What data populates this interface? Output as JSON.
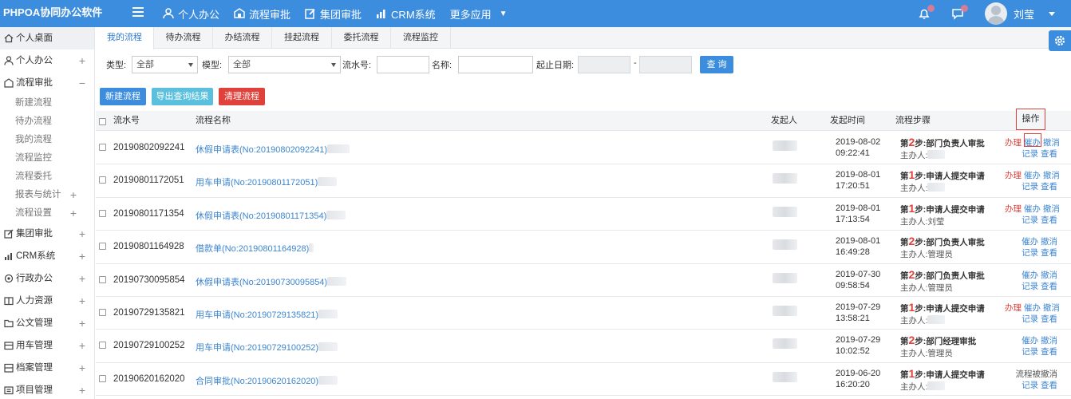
{
  "app": {
    "brand": "PHPOA协同办公软件",
    "user_name": "刘莹",
    "colors": {
      "primary": "#3c8dde",
      "danger": "#e0413a",
      "info": "#5bc0de",
      "link": "#3d86cf"
    }
  },
  "topnav": {
    "items": [
      {
        "label": "个人办公",
        "icon": "user-icon"
      },
      {
        "label": "流程审批",
        "icon": "workflow-icon"
      },
      {
        "label": "集团审批",
        "icon": "edit-icon"
      },
      {
        "label": "CRM系统",
        "icon": "bar-chart-icon"
      }
    ],
    "more_label": "更多应用"
  },
  "sidebar": {
    "items": [
      {
        "label": "个人桌面",
        "icon": "home-icon",
        "toggle": ""
      },
      {
        "label": "个人办公",
        "icon": "user-icon",
        "toggle": "+"
      },
      {
        "label": "流程审批",
        "icon": "workflow-icon",
        "toggle": "−"
      },
      {
        "label": "集团审批",
        "icon": "edit-icon",
        "toggle": "+"
      },
      {
        "label": "CRM系统",
        "icon": "bar-chart-icon",
        "toggle": "+"
      },
      {
        "label": "行政办公",
        "icon": "gear-icon",
        "toggle": "+"
      },
      {
        "label": "人力资源",
        "icon": "book-icon",
        "toggle": "+"
      },
      {
        "label": "公文管理",
        "icon": "folder-icon",
        "toggle": "+"
      },
      {
        "label": "用车管理",
        "icon": "car-icon",
        "toggle": "+"
      },
      {
        "label": "档案管理",
        "icon": "archive-icon",
        "toggle": "+"
      },
      {
        "label": "项目管理",
        "icon": "project-icon",
        "toggle": "+"
      }
    ],
    "sub_items": [
      {
        "label": "新建流程",
        "toggle": ""
      },
      {
        "label": "待办流程",
        "toggle": ""
      },
      {
        "label": "我的流程",
        "toggle": ""
      },
      {
        "label": "流程监控",
        "toggle": ""
      },
      {
        "label": "流程委托",
        "toggle": ""
      },
      {
        "label": "报表与统计",
        "toggle": "+"
      },
      {
        "label": "流程设置",
        "toggle": "+"
      }
    ]
  },
  "tabs": [
    "我的流程",
    "待办流程",
    "办结流程",
    "挂起流程",
    "委托流程",
    "流程监控"
  ],
  "filter": {
    "type_label": "类型:",
    "type_value": "全部",
    "model_label": "模型:",
    "model_value": "全部",
    "serial_label": "流水号:",
    "name_label": "名称:",
    "date_label": "起止日期:",
    "date_sep": "-",
    "query_label": "查 询"
  },
  "actions": {
    "new_label": "新建流程",
    "export_label": "导出查询结果",
    "clear_label": "清理流程"
  },
  "table": {
    "headers": {
      "serial": "流水号",
      "name": "流程名称",
      "initiator": "发起人",
      "time": "发起时间",
      "step": "流程步骤",
      "ops": "操作"
    },
    "step_prefix": "第",
    "step_suffix": "步:",
    "handler_label": "主办人:",
    "rows": [
      {
        "serial": "20190802092241",
        "name": "休假申请表(No:20190802092241)",
        "date": "2019-08-02",
        "time": "09:22:41",
        "step_no": "2",
        "step_name": "部门负责人审批",
        "handler": "",
        "op1": "办理",
        "op2": "催办",
        "op3": "撤消",
        "op4": "记录",
        "op5": "查看"
      },
      {
        "serial": "20190801172051",
        "name": "用车申请(No:20190801172051)",
        "date": "2019-08-01",
        "time": "17:20:51",
        "step_no": "1",
        "step_name": "申请人提交申请",
        "handler": "",
        "op1": "办理",
        "op2": "催办",
        "op3": "撤消",
        "op4": "记录",
        "op5": "查看"
      },
      {
        "serial": "20190801171354",
        "name": "休假申请表(No:20190801171354)",
        "date": "2019-08-01",
        "time": "17:13:54",
        "step_no": "1",
        "step_name": "申请人提交申请",
        "handler": "刘莹",
        "op1": "办理",
        "op2": "催办",
        "op3": "撤消",
        "op4": "记录",
        "op5": "查看"
      },
      {
        "serial": "20190801164928",
        "name": "借款单(No:20190801164928)",
        "date": "2019-08-01",
        "time": "16:49:28",
        "step_no": "2",
        "step_name": "部门负责人审批",
        "handler": "管理员",
        "op1": "",
        "op2": "催办",
        "op3": "撤消",
        "op4": "记录",
        "op5": "查看"
      },
      {
        "serial": "20190730095854",
        "name": "休假申请表(No:20190730095854)",
        "date": "2019-07-30",
        "time": "09:58:54",
        "step_no": "2",
        "step_name": "部门负责人审批",
        "handler": "管理员",
        "op1": "",
        "op2": "催办",
        "op3": "撤消",
        "op4": "记录",
        "op5": "查看"
      },
      {
        "serial": "20190729135821",
        "name": "用车申请(No:20190729135821)",
        "date": "2019-07-29",
        "time": "13:58:21",
        "step_no": "1",
        "step_name": "申请人提交申请",
        "handler": "",
        "op1": "办理",
        "op2": "催办",
        "op3": "撤消",
        "op4": "记录",
        "op5": "查看"
      },
      {
        "serial": "20190729100252",
        "name": "用车申请(No:20190729100252)",
        "date": "2019-07-29",
        "time": "10:02:52",
        "step_no": "2",
        "step_name": "部门经理审批",
        "handler": "管理员",
        "op1": "",
        "op2": "催办",
        "op3": "撤消",
        "op4": "记录",
        "op5": "查看"
      },
      {
        "serial": "20190620162020",
        "name": "合同审批(No:20190620162020)",
        "date": "2019-06-20",
        "time": "16:20:20",
        "step_no": "1",
        "step_name": "申请人提交申请",
        "handler": "",
        "op1": "流程被撤消",
        "op2": "",
        "op3": "",
        "op4": "记录",
        "op5": "查看"
      }
    ]
  }
}
